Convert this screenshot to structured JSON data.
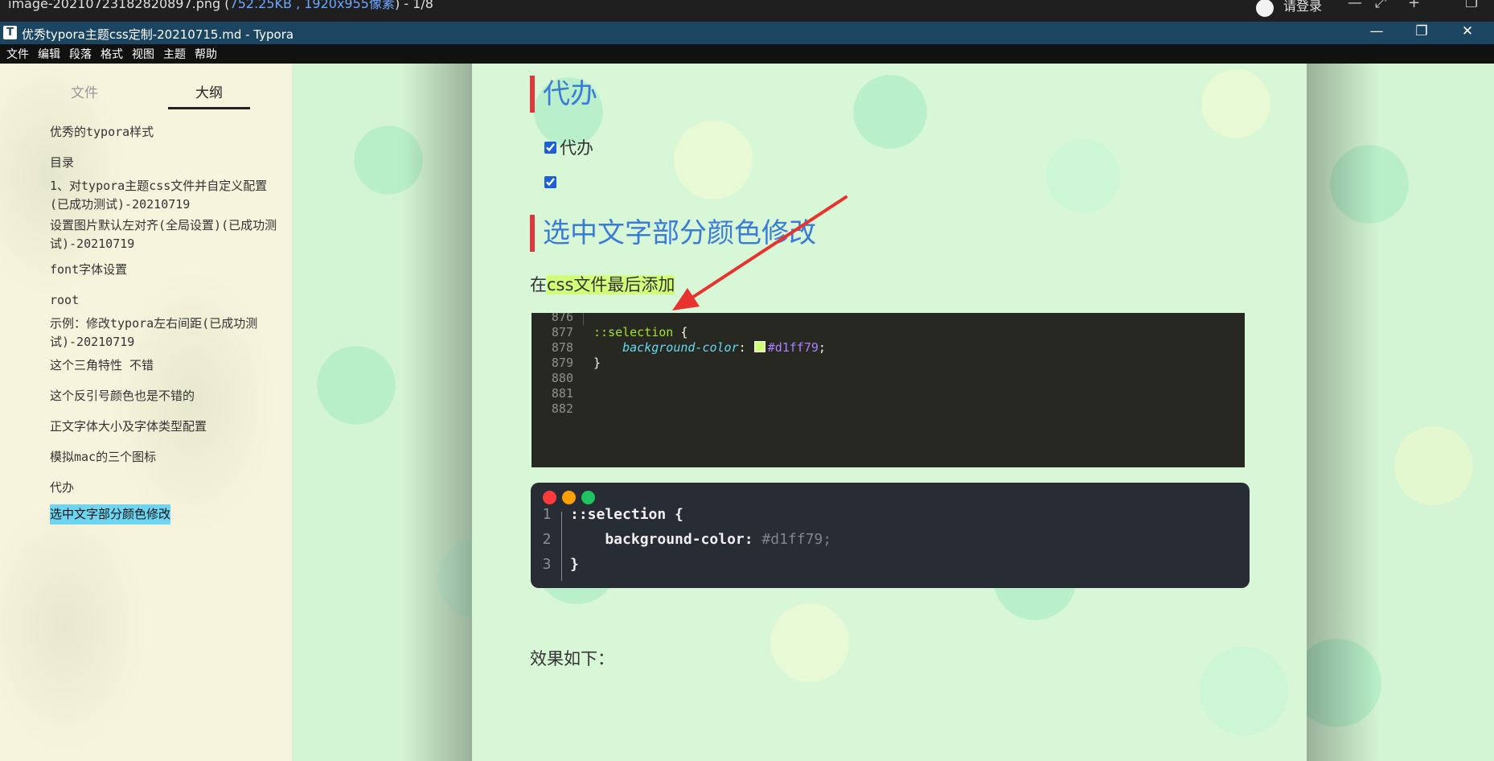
{
  "viewer_bar": {
    "file_prefix": "image-20210723182820897.png (",
    "file_size": "752.25KB , 1920x955像素",
    "file_suffix": ") - 1/8",
    "login_label": "请登录"
  },
  "window": {
    "app_icon_letter": "T",
    "title": "优秀typora主题css定制-20210715.md - Typora",
    "controls": {
      "minimize": "—",
      "maximize": "❐",
      "close": "✕"
    }
  },
  "menubar": [
    "文件",
    "编辑",
    "段落",
    "格式",
    "视图",
    "主题",
    "帮助"
  ],
  "sidebar": {
    "tabs": {
      "files": "文件",
      "outline": "大纲"
    },
    "active_tab": "outline",
    "outline_items": [
      "优秀的typora样式",
      "目录",
      "1、对typora主题css文件并自定义配置(已成功测试)-20210719",
      "设置图片默认左对齐(全局设置)(已成功测试)-20210719",
      "font字体设置",
      "root",
      "示例：修改typora左右间距(已成功测试)-20210719",
      "这个三角特性 不错",
      "这个反引号颜色也是不错的",
      "正文字体大小及字体类型配置",
      "模拟mac的三个图标",
      "代办",
      "选中文字部分颜色修改"
    ],
    "selected_item": "选中文字部分颜色修改"
  },
  "document": {
    "heading_todo": "代办",
    "task_1_label": "代办",
    "task_1_checked": true,
    "task_2_checked": true,
    "heading_selection": "选中文字部分颜色修改",
    "para_prefix": "在",
    "para_highlighted": "css文件最后添加",
    "code_block_1": {
      "lines": [
        {
          "n": "876",
          "selector": "",
          "text": ""
        },
        {
          "n": "877",
          "selector": "::selection",
          "text": " {"
        },
        {
          "n": "878",
          "prop": "background-color",
          "value": "#d1ff79"
        },
        {
          "n": "879",
          "text": "}"
        },
        {
          "n": "880",
          "text": ""
        },
        {
          "n": "881",
          "text": ""
        },
        {
          "n": "882",
          "text": ""
        }
      ],
      "swatch_color": "#d1ff79"
    },
    "code_block_2": {
      "lines": [
        {
          "n": "1",
          "code": "::selection {"
        },
        {
          "n": "2",
          "prop": "    background-color:",
          "value": " #d1ff79;"
        },
        {
          "n": "3",
          "code": "}"
        }
      ]
    },
    "effect_label": "效果如下："
  },
  "colors": {
    "accent_heading": "#3a7bd5",
    "heading_bar": "#e2363a",
    "selection_highlight": "#d1ff79",
    "outline_selected": "#6cd6f2",
    "arrow": "#e8322f"
  }
}
